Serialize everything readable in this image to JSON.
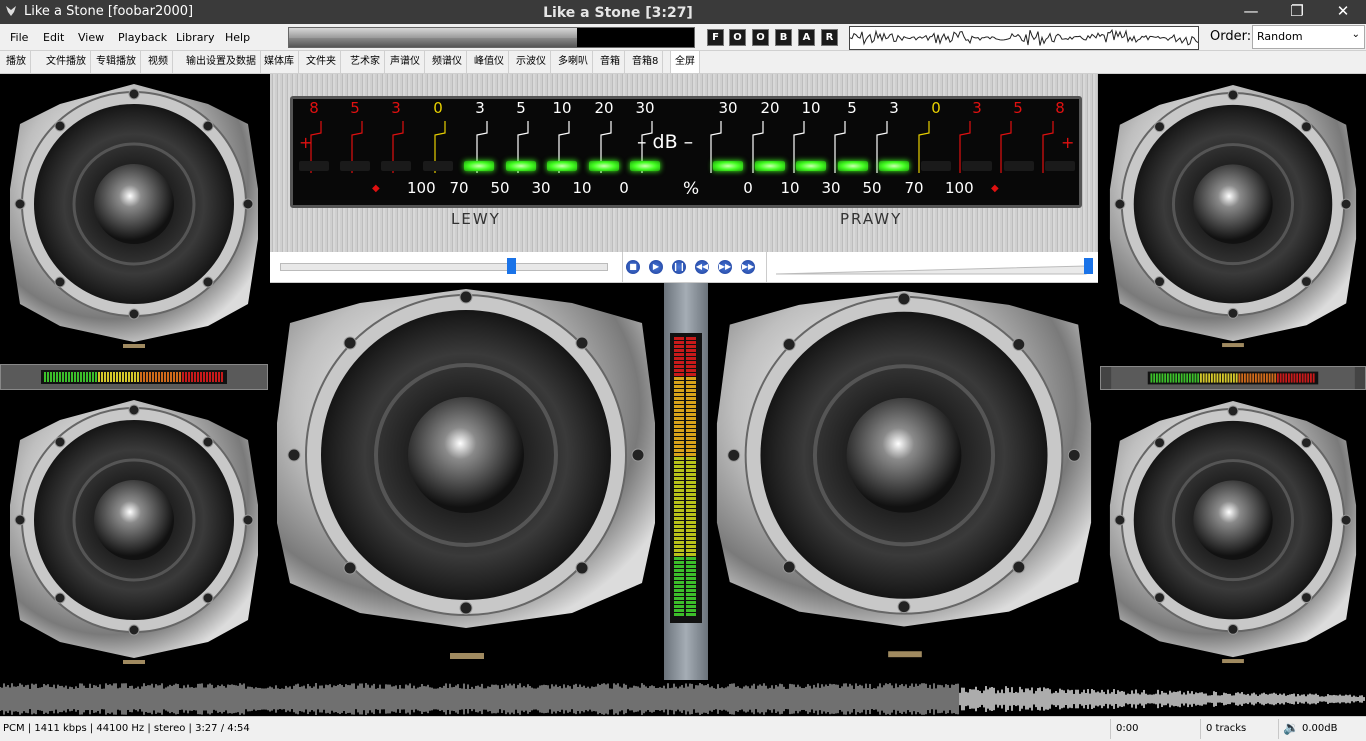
{
  "window": {
    "app_title": "Like a Stone  [foobar2000]",
    "now_playing": "Like a Stone [3:27]",
    "minimize_icon": "minimize-icon",
    "restore_icon": "restore-icon",
    "close_icon": "close-icon"
  },
  "menu": [
    "File",
    "Edit",
    "View",
    "Playback",
    "Library",
    "Help"
  ],
  "toolbar": {
    "seek_progress": 0.71,
    "buttons": [
      "F",
      "O",
      "O",
      "B",
      "A",
      "R"
    ],
    "order_label": "Order:",
    "order_value": "Random"
  },
  "tabs": [
    "播放",
    "文件播放",
    "专辑播放",
    "视频",
    "输出设置及数据",
    "媒体库",
    "文件夹",
    "艺术家",
    "声谱仪",
    "频谱仪",
    "峰值仪",
    "示波仪",
    "多喇叭",
    "音箱",
    "音箱8",
    "全屏"
  ],
  "active_tab": "全屏",
  "meter": {
    "db_label": "– dB –",
    "left_scale": [
      "8",
      "5",
      "3",
      "0",
      "3",
      "5",
      "10",
      "20",
      "30"
    ],
    "right_scale": [
      "30",
      "20",
      "10",
      "5",
      "3",
      "0",
      "3",
      "5",
      "8"
    ],
    "plus": "+",
    "percent_left": [
      "100",
      "70",
      "50",
      "30",
      "10",
      "0"
    ],
    "percent_sign": "%",
    "percent_right": [
      "0",
      "10",
      "30",
      "50",
      "70",
      "100"
    ],
    "left_channel": "LEWY",
    "right_channel": "PRAWY",
    "left_level": 0.55,
    "right_level": 0.55,
    "colors": {
      "red": "#e01010",
      "yellow": "#e8d000",
      "green": "#44ff22"
    }
  },
  "transport": {
    "position": 0.71,
    "volume": 1.0,
    "buttons": [
      "stop-icon",
      "play-icon",
      "pause-icon",
      "previous-icon",
      "next-icon",
      "random-icon"
    ]
  },
  "status": {
    "format": "PCM | 1411 kbps | 44100 Hz | stereo | 3:27 / 4:54",
    "selection": "0:00",
    "tracks": "0 tracks",
    "volume": "0.00dB"
  }
}
